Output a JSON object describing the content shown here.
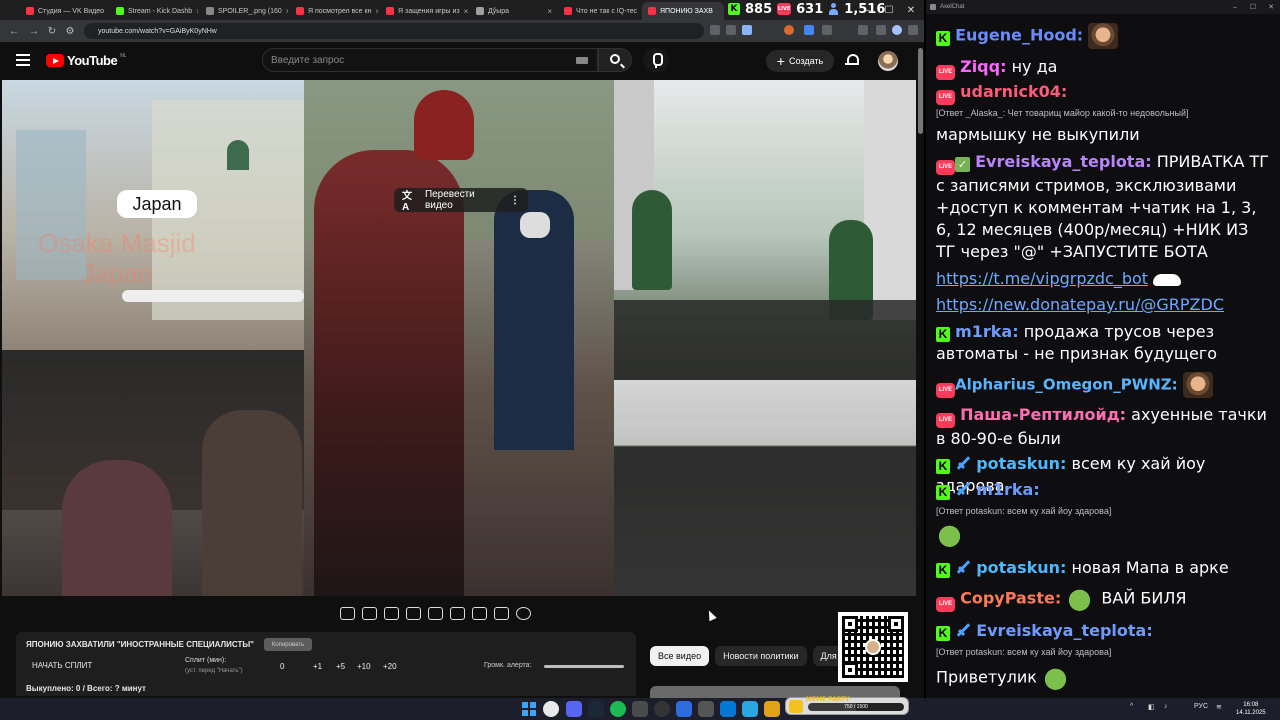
{
  "browser": {
    "tabs": [
      {
        "title": "Студия — VK Видео",
        "color": "#ff3347"
      },
      {
        "title": "Stream - Kick Dashb",
        "color": "#53fc18"
      },
      {
        "title": "SPOILER_.png (160",
        "color": "#888888"
      },
      {
        "title": "Я посмотрел все кн",
        "color": "#ff3347"
      },
      {
        "title": "Я защения игры из",
        "color": "#ff3347"
      },
      {
        "title": "Дўыра",
        "color": "#a0a0a0"
      },
      {
        "title": "Что не так с IQ-тес",
        "color": "#ff3347"
      },
      {
        "title": "ЯПОНИЮ ЗАХВ",
        "color": "#ff3347"
      }
    ],
    "url": "youtube.com/watch?v=GAiByK0yNHw"
  },
  "counters": {
    "kick": "885",
    "live": "631",
    "viewers": "1,516",
    "kick_badge": "K",
    "live_badge": "LIVE"
  },
  "youtube": {
    "logo_text": "YouTube",
    "logo_region": "NL",
    "search_placeholder": "Введите запрос",
    "create_label": "Создать"
  },
  "video": {
    "city_label": "Japan",
    "watermark": "Osaka Masjid Japan",
    "translate_label": "Перевести видео"
  },
  "split_panel": {
    "title": "ЯПОНИЮ ЗАХВАТИЛИ \"ИНОСТРАННЫЕ СПЕЦИАЛИСТЫ\"",
    "copy_label": "Копировать",
    "start_label": "НАЧАТЬ СПЛИТ",
    "split_min_label": "Сплит (мин):",
    "split_hint": "(уст. перед \"Начать\")",
    "split_value": "0",
    "increments": [
      "+1",
      "+5",
      "+10",
      "+20"
    ],
    "alert_label": "Громк. алерта:",
    "bought_line": "Выкуплено: 0 / Всего: ? минут"
  },
  "filters": [
    "Все видео",
    "Новости политики",
    "Для в"
  ],
  "chat": {
    "title": "AxelChat",
    "messages": [
      {
        "badges": [
          "kick"
        ],
        "name": "Eugene_Hood:",
        "name_color": "#6b8cff",
        "text": "",
        "emote": "face"
      },
      {
        "badges": [
          "live"
        ],
        "name": "Ziqq:",
        "name_color": "#ff66ff",
        "text": "ну да"
      },
      {
        "badges": [
          "live"
        ],
        "name": "udarnick04:",
        "name_color": "#ff5b7a",
        "text": ""
      },
      {
        "reply": "[Ответ _Alaska_: Чет товарищ майор какой-то недовольный]"
      },
      {
        "text": "мармышку не выкупили"
      },
      {
        "badges": [
          "live",
          "check"
        ],
        "name": "Evreiskaya_teplota:",
        "name_color": "#b985ff",
        "text": "ПРИВАТКА ТГ с записями стримов, эксклюзивами +доступ к комментам +чатик на 1, 3, 6, 12 месяцев (400р/месяц) +НИК ИЗ ТГ через \"@\" +ЗАПУСТИТЕ БОТА"
      },
      {
        "link": "https://t.me/vipgrpzdc_bot"
      },
      {
        "link": "https://new.donatepay.ru/@GRPZDC"
      },
      {
        "badges": [
          "kick"
        ],
        "name": "m1rka:",
        "name_color": "#6f9bff",
        "text": "продажа трусов через автоматы - не признак будущего"
      },
      {
        "badges": [
          "live"
        ],
        "name": "Alpharius_Omegon_PWNZ:",
        "name_color": "#5ab3ff",
        "text": ""
      },
      {
        "badges": [
          "live"
        ],
        "name": "Паша-Рептилойд:",
        "name_color": "#ff6fb0",
        "text": "ахуенные тачки в 80-90-е были"
      },
      {
        "badges": [
          "kick",
          "sword"
        ],
        "name": "potaskun:",
        "name_color": "#4fb6ff",
        "text": "всем ку хай йоу здарова"
      },
      {
        "badges": [
          "kick",
          "sword"
        ],
        "name": "m1rka:",
        "name_color": "#6f9bff",
        "text": ""
      },
      {
        "reply": "[Ответ potaskun: всем ку хай йоу здарова]"
      },
      {
        "badges": [
          "kick",
          "sword"
        ],
        "name": "potaskun:",
        "name_color": "#4fb6ff",
        "text": "новая Мапа в арке"
      },
      {
        "badges": [
          "live"
        ],
        "name": "CopyPaste:",
        "name_color": "#ff7a5a",
        "text": "ВАЙ БИЛЯ"
      },
      {
        "badges": [
          "kick",
          "sword"
        ],
        "name": "Evreiskaya_teplota:",
        "name_color": "#6f9bff",
        "text": ""
      },
      {
        "reply": "[Ответ potaskun: всем ку хай йоу здарова]"
      },
      {
        "text": "Приветулик"
      }
    ]
  },
  "taskbar": {
    "meme_label": "MEME PARTY",
    "meme_progress_text": "750 / 1500",
    "meme_progress": 0.5,
    "lang": "РУС",
    "time": "16:08",
    "date": "14.11.2025"
  }
}
